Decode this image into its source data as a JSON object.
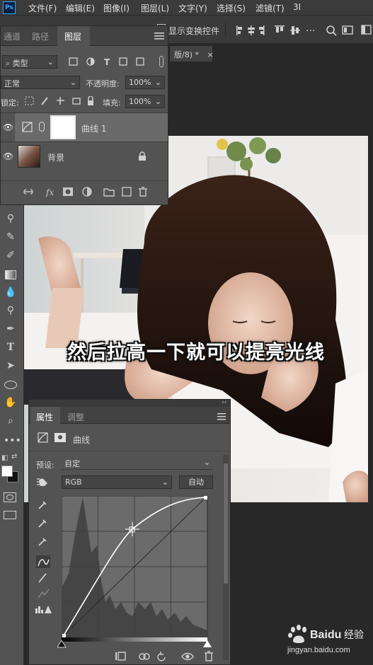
{
  "menubar": {
    "logo": "Ps",
    "items": [
      "文件(F)",
      "编辑(E)",
      "图像(I)",
      "图层(L)",
      "文字(Y)",
      "选择(S)",
      "滤镜(T)",
      "3I"
    ]
  },
  "options_bar": {
    "transform_label": "显示变换控件"
  },
  "document": {
    "tab_label": "版/8) *",
    "tab_close": "×"
  },
  "layers_panel": {
    "tabs": [
      "通道",
      "路径",
      "图层"
    ],
    "active_tab": "图层",
    "filter_label": "类型",
    "blend_mode": "正常",
    "opacity_label": "不透明度:",
    "opacity_value": "100%",
    "lock_label": "锁定:",
    "fill_label": "填充:",
    "fill_value": "100%",
    "layers": [
      {
        "name": "曲线 1",
        "type": "adjustment",
        "selected": true
      },
      {
        "name": "背景",
        "type": "background",
        "locked": true
      }
    ]
  },
  "properties_panel": {
    "tabs": [
      "属性",
      "调整"
    ],
    "active_tab": "属性",
    "adjustment_title": "曲线",
    "preset_label": "预设:",
    "preset_value": "自定",
    "channel_value": "RGB",
    "auto_button": "自动"
  },
  "caption": "然后拉高一下就可以提亮光线",
  "watermark": {
    "brand": "Baidu",
    "brand_cn": "经验",
    "url": "jingyan.baidu.com"
  },
  "colors": {
    "panel_bg": "#535353",
    "app_bg": "#282828",
    "accent": "#31a8ff"
  }
}
